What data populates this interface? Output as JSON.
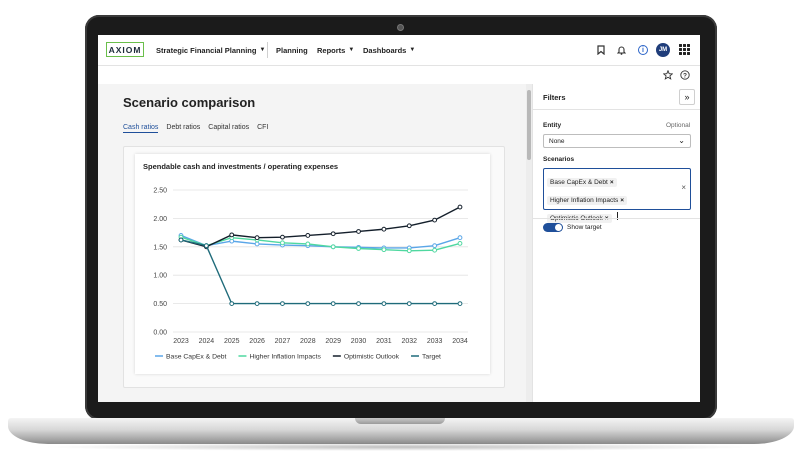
{
  "app": {
    "logo": "AXIOM",
    "product": "Strategic Financial Planning",
    "nav": [
      "Planning",
      "Reports",
      "Dashboards"
    ],
    "avatar_initials": "JM",
    "info_icon_glyph": "i"
  },
  "page": {
    "title": "Scenario comparison",
    "tabs": [
      "Cash ratios",
      "Debt ratios",
      "Capital ratios",
      "CFI"
    ]
  },
  "chart_data": {
    "type": "line",
    "title": "Spendable cash and investments / operating expenses",
    "categories": [
      "2023",
      "2024",
      "2025",
      "2026",
      "2027",
      "2028",
      "2029",
      "2030",
      "2031",
      "2032",
      "2033",
      "2034"
    ],
    "ylim": [
      0,
      2.5
    ],
    "yticks": [
      "2.50",
      "2.00",
      "1.50",
      "1.00",
      "0.50",
      "0.00"
    ],
    "grid": true,
    "legend_position": "bottom",
    "series": [
      {
        "name": "Base CapEx & Debt",
        "color": "#5aa6e8",
        "values": [
          1.7,
          1.52,
          1.6,
          1.55,
          1.53,
          1.52,
          1.5,
          1.49,
          1.48,
          1.48,
          1.52,
          1.66
        ]
      },
      {
        "name": "Higher Inflation Impacts",
        "color": "#4fd8a0",
        "values": [
          1.67,
          1.52,
          1.66,
          1.62,
          1.57,
          1.55,
          1.5,
          1.47,
          1.45,
          1.43,
          1.44,
          1.56
        ]
      },
      {
        "name": "Optimistic Outlook",
        "color": "#141f2b",
        "values": [
          1.62,
          1.5,
          1.71,
          1.66,
          1.67,
          1.7,
          1.73,
          1.77,
          1.81,
          1.87,
          1.97,
          2.2
        ]
      },
      {
        "name": "Target",
        "color": "#1f6b7a",
        "values": [
          1.62,
          1.52,
          0.5,
          0.5,
          0.5,
          0.5,
          0.5,
          0.5,
          0.5,
          0.5,
          0.5,
          0.5
        ]
      }
    ]
  },
  "filters": {
    "title": "Filters",
    "collapse_glyph": "»",
    "entity_label": "Entity",
    "entity_optional": "Optional",
    "entity_value": "None",
    "scenarios_label": "Scenarios",
    "scenarios": [
      "Base CapEx & Debt",
      "Higher Inflation Impacts",
      "Optimistic Outlook"
    ],
    "show_target_label": "Show target",
    "show_target": true
  }
}
